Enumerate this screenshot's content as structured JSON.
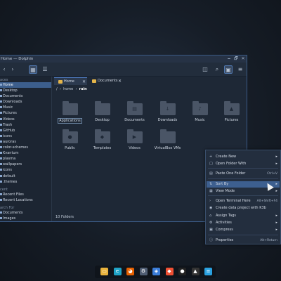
{
  "window": {
    "title": "Home — Dolphin",
    "controls": [
      "🗕",
      "🗗",
      "✕"
    ]
  },
  "toolbar": {
    "back": "‹",
    "forward": "›",
    "view_icons": "▦",
    "view_details": "☰",
    "split": "◫",
    "search": "⌕",
    "preview": "▣",
    "menu": "≡"
  },
  "sidebar": {
    "places_header": "aces",
    "items": [
      {
        "label": "Home",
        "active": true
      },
      {
        "label": "Desktop"
      },
      {
        "label": "Documents"
      },
      {
        "label": "Downloads"
      },
      {
        "label": "Music"
      },
      {
        "label": "Pictures"
      },
      {
        "label": "Videos"
      },
      {
        "label": "Trash"
      },
      {
        "label": "GitHub"
      },
      {
        "label": "icons"
      },
      {
        "label": "auroras"
      },
      {
        "label": "color-schemes"
      },
      {
        "label": "Kvantum"
      },
      {
        "label": "plasma"
      },
      {
        "label": "wallpapers"
      },
      {
        "label": "icons"
      },
      {
        "label": "default"
      },
      {
        "label": ".themes"
      }
    ],
    "recent_header": "cent",
    "recent_items": [
      {
        "label": "Recent Files"
      },
      {
        "label": "Recent Locations"
      }
    ],
    "search_header": "arch For",
    "search_items": [
      {
        "label": "Documents"
      },
      {
        "label": "Images"
      }
    ]
  },
  "tabs": [
    {
      "label": "Home",
      "active": true,
      "close": "✕"
    },
    {
      "label": "Documents",
      "active": false,
      "close": "✕"
    }
  ],
  "breadcrumb": {
    "root": "/",
    "sep": "›",
    "home": "home",
    "user": "rain"
  },
  "files": [
    {
      "name": "Applications",
      "glyph": "",
      "selected": true
    },
    {
      "name": "Desktop",
      "glyph": ""
    },
    {
      "name": "Documents",
      "glyph": "▤"
    },
    {
      "name": "Downloads",
      "glyph": "↓"
    },
    {
      "name": "Music",
      "glyph": "♪"
    },
    {
      "name": "Pictures",
      "glyph": "▲"
    },
    {
      "name": "Public",
      "glyph": "●"
    },
    {
      "name": "Templates",
      "glyph": "◆"
    },
    {
      "name": "Videos",
      "glyph": "▶"
    },
    {
      "name": "VirtualBox VMs",
      "glyph": ""
    }
  ],
  "status": {
    "count": "10 Folders"
  },
  "context_menu": [
    {
      "label": "Create New",
      "icon": "+",
      "arrow": "▸"
    },
    {
      "label": "Open Folder With",
      "icon": "□",
      "arrow": "▸"
    },
    {
      "label": "Paste One Folder",
      "icon": "▤",
      "shortcut": "Ctrl+V"
    },
    {
      "label": "Sort By",
      "icon": "⇅",
      "arrow": "▸",
      "highlight": true
    },
    {
      "label": "View Mode",
      "icon": "▦",
      "arrow": "▸"
    },
    {
      "label": "Open Terminal Here",
      "icon": "›",
      "shortcut": "Alt+Shift+F4"
    },
    {
      "label": "Create data project with K3b",
      "icon": "◉"
    },
    {
      "label": "Assign Tags",
      "icon": "⌂",
      "arrow": "▸"
    },
    {
      "label": "Activities",
      "icon": "⚙",
      "arrow": "▸"
    },
    {
      "label": "Compress",
      "icon": "▣",
      "arrow": "▸"
    },
    {
      "label": "Properties",
      "icon": "ⓘ",
      "shortcut": "Alt+Return"
    }
  ],
  "taskbar": [
    {
      "name": "files",
      "glyph": "▭",
      "color": "#e9b33d"
    },
    {
      "name": "edge",
      "glyph": "e",
      "color": "#1fa3c7"
    },
    {
      "name": "firefox",
      "glyph": "◕",
      "color": "#e66000"
    },
    {
      "name": "settings",
      "glyph": "⚙",
      "color": "#4f5d73"
    },
    {
      "name": "kde",
      "glyph": "◈",
      "color": "#3b7dd8"
    },
    {
      "name": "git",
      "glyph": "◆",
      "color": "#f05033"
    },
    {
      "name": "github",
      "glyph": "●",
      "color": "#222"
    },
    {
      "name": "inkscape",
      "glyph": "▲",
      "color": "#333"
    },
    {
      "name": "notes",
      "glyph": "≡",
      "color": "#2aa1e0"
    }
  ],
  "colors": {
    "accent": "#3d5f8f",
    "folder": "#4a5566",
    "tab_folder": "#e4b54a"
  }
}
